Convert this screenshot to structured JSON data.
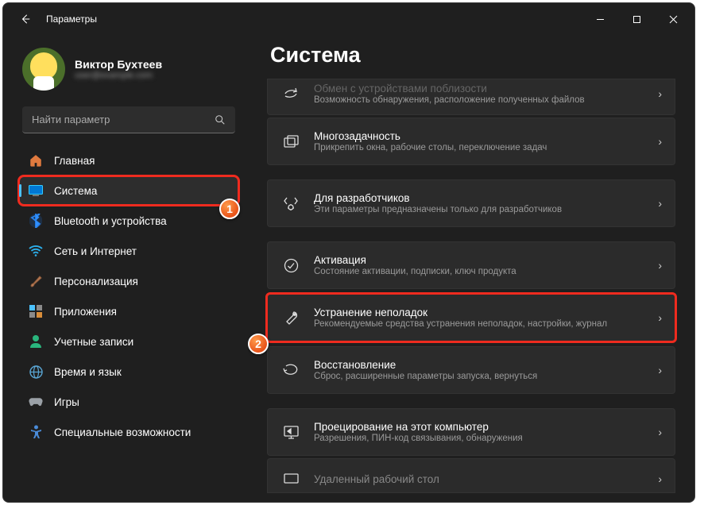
{
  "window": {
    "title": "Параметры"
  },
  "user": {
    "name": "Виктор Бухтеев",
    "email": "user@example.com"
  },
  "search": {
    "placeholder": "Найти параметр"
  },
  "nav": {
    "items": [
      {
        "label": "Главная",
        "icon": "home"
      },
      {
        "label": "Система",
        "icon": "system",
        "active": true
      },
      {
        "label": "Bluetooth и устройства",
        "icon": "bluetooth"
      },
      {
        "label": "Сеть и Интернет",
        "icon": "wifi"
      },
      {
        "label": "Персонализация",
        "icon": "brush"
      },
      {
        "label": "Приложения",
        "icon": "apps"
      },
      {
        "label": "Учетные записи",
        "icon": "account"
      },
      {
        "label": "Время и язык",
        "icon": "time"
      },
      {
        "label": "Игры",
        "icon": "games"
      },
      {
        "label": "Специальные возможности",
        "icon": "accessibility"
      }
    ]
  },
  "main": {
    "heading": "Система",
    "rows": [
      {
        "title": "Обмен с устройствами поблизости",
        "sub": "Возможность обнаружения, расположение полученных файлов",
        "icon": "share",
        "cutoff": "top"
      },
      {
        "title": "Многозадачность",
        "sub": "Прикрепить окна, рабочие столы, переключение задач",
        "icon": "multitask"
      },
      {
        "gap": true
      },
      {
        "title": "Для разработчиков",
        "sub": "Эти параметры предназначены только для разработчиков",
        "icon": "dev"
      },
      {
        "gap": true
      },
      {
        "title": "Активация",
        "sub": "Состояние активации, подписки, ключ продукта",
        "icon": "activation"
      },
      {
        "title": "Устранение неполадок",
        "sub": "Рекомендуемые средства устранения неполадок, настройки, журнал",
        "icon": "troubleshoot",
        "highlight": true
      },
      {
        "title": "Восстановление",
        "sub": "Сброс, расширенные параметры запуска, вернуться",
        "icon": "recovery"
      },
      {
        "gap": true
      },
      {
        "title": "Проецирование на этот компьютер",
        "sub": "Разрешения, ПИН-код связывания, обнаружения",
        "icon": "project"
      },
      {
        "title": "Удаленный рабочий стол",
        "sub": "",
        "icon": "remote",
        "cutoff": "bottom"
      }
    ]
  },
  "steps": {
    "one": "1",
    "two": "2"
  }
}
